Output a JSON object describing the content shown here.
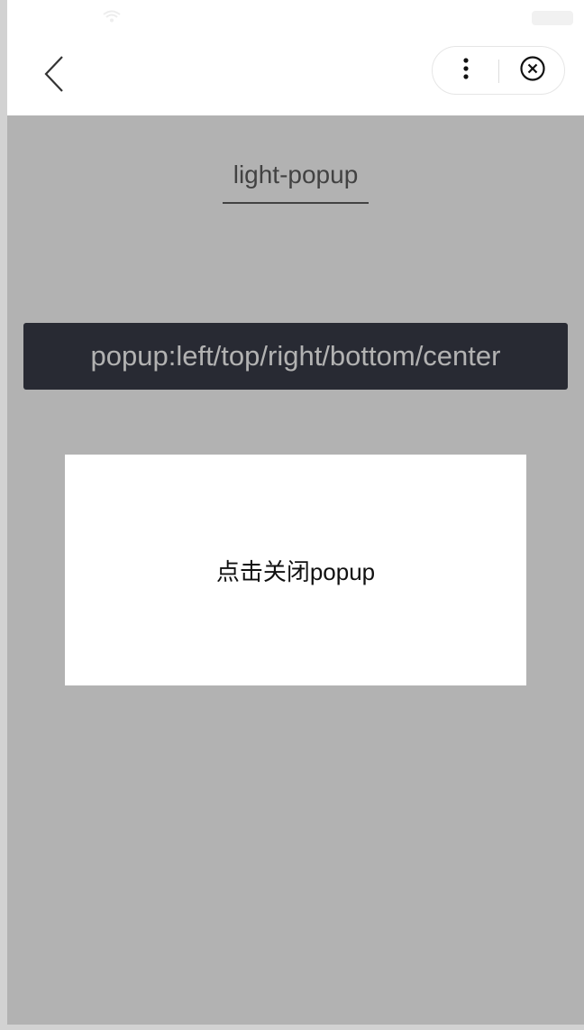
{
  "status_bar": {
    "wifi_icon": "wifi-icon",
    "battery_icon": "battery-icon"
  },
  "nav_bar": {
    "back_icon": "chevron-left-icon",
    "more_icon": "more-vertical-icon",
    "close_icon": "close-circle-icon"
  },
  "page": {
    "title": "light-popup",
    "button_label": "popup:left/top/right/bottom/center"
  },
  "popup": {
    "position": "center",
    "text": "点击关闭popup"
  },
  "colors": {
    "button_bg": "#3a3d49",
    "mask": "rgba(0,0,0,0.3)",
    "popup_bg": "#ffffff"
  }
}
